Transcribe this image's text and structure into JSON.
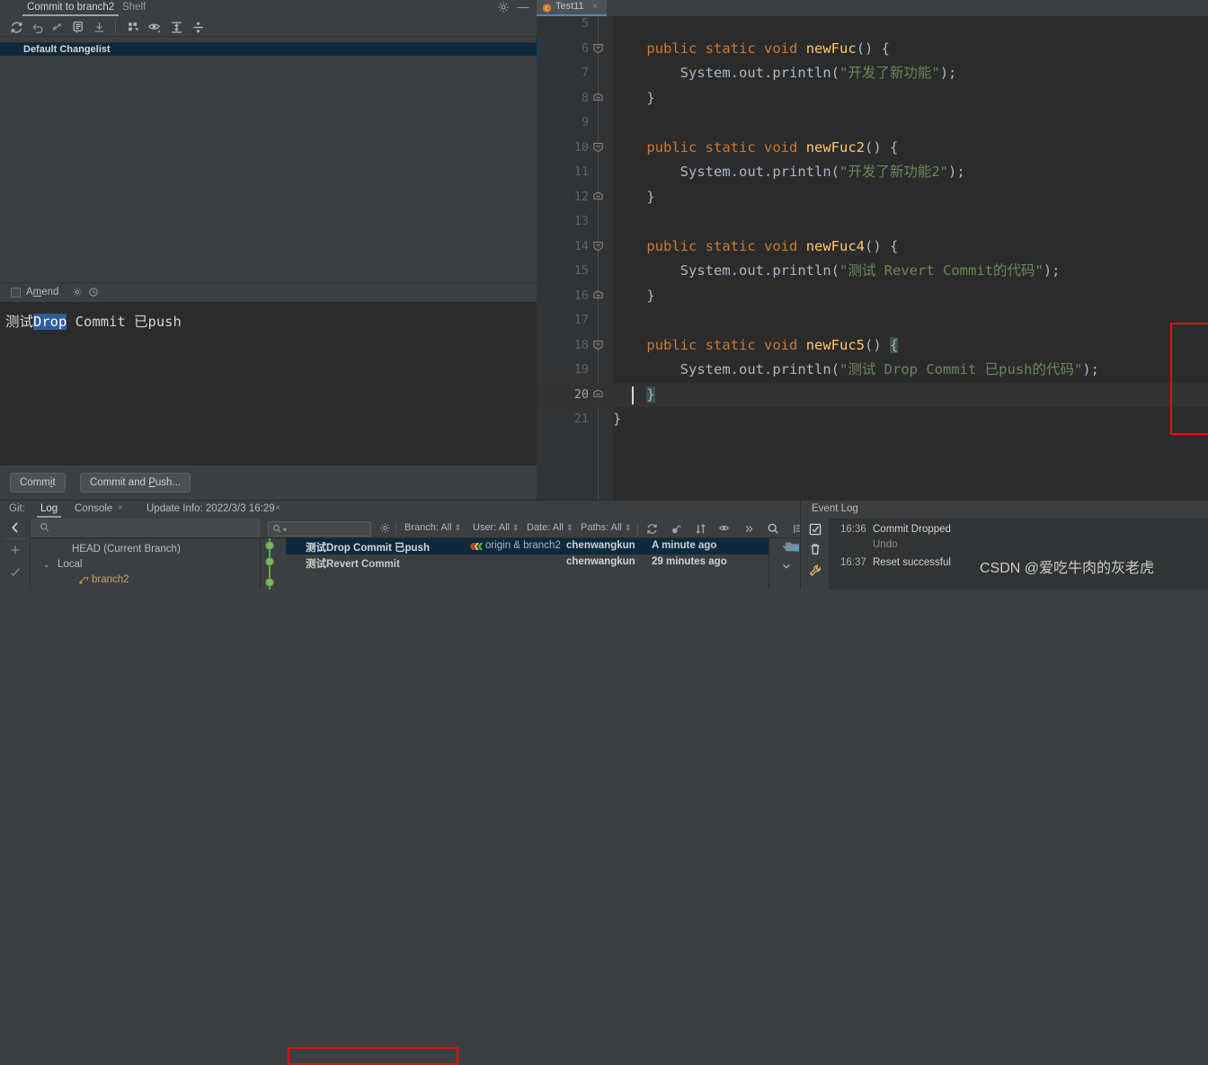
{
  "commit_panel": {
    "tabs": [
      {
        "label": "Commit to branch2",
        "selected": true
      },
      {
        "label": "Shelf",
        "selected": false
      }
    ],
    "toolbar_icons": [
      "refresh-icon",
      "rollback-icon",
      "show-diff-icon",
      "commit-message-icon",
      "shelve-icon",
      "group-by-icon",
      "preview-diff-icon",
      "expand-all-icon",
      "collapse-all-icon"
    ],
    "changelist": "Default Changelist",
    "amend_label": "Amend",
    "commit_message": {
      "before": "测试",
      "selected": "Drop",
      "after": " Commit 已push"
    },
    "buttons": {
      "commit": "Commit",
      "commit_and_push": "Commit and Push..."
    }
  },
  "editor": {
    "tab": {
      "label": "Test11",
      "close": "×"
    },
    "lines": [
      {
        "num": "5",
        "fold": "",
        "code": ""
      },
      {
        "num": "6",
        "fold": "minus",
        "code": "    public static void newFuc() {"
      },
      {
        "num": "7",
        "fold": "",
        "code": "        System.out.println(\"开发了新功能\");"
      },
      {
        "num": "8",
        "fold": "end",
        "code": "    }"
      },
      {
        "num": "9",
        "fold": "",
        "code": ""
      },
      {
        "num": "10",
        "fold": "minus",
        "code": "    public static void newFuc2() {"
      },
      {
        "num": "11",
        "fold": "",
        "code": "        System.out.println(\"开发了新功能2\");"
      },
      {
        "num": "12",
        "fold": "end",
        "code": "    }"
      },
      {
        "num": "13",
        "fold": "",
        "code": ""
      },
      {
        "num": "14",
        "fold": "minus",
        "code": "    public static void newFuc4() {"
      },
      {
        "num": "15",
        "fold": "",
        "code": "        System.out.println(\"测试 Revert Commit的代码\");"
      },
      {
        "num": "16",
        "fold": "end",
        "code": "    }"
      },
      {
        "num": "17",
        "fold": "",
        "code": ""
      },
      {
        "num": "18",
        "fold": "minus",
        "code": "    public static void newFuc5() {"
      },
      {
        "num": "19",
        "fold": "",
        "code": "        System.out.println(\"测试 Drop Commit 已push的代码\");"
      },
      {
        "num": "20",
        "fold": "end",
        "code": "    }"
      },
      {
        "num": "21",
        "fold": "",
        "code": "}"
      }
    ]
  },
  "bottom": {
    "git_label": "Git:",
    "tabs": [
      {
        "label": "Log",
        "selected": true,
        "closable": false
      },
      {
        "label": "Console",
        "selected": false,
        "closable": true
      },
      {
        "label": "Update Info: 2022/3/3 16:29",
        "selected": false,
        "closable": true
      }
    ],
    "branch_tree": [
      {
        "label": "HEAD (Current Branch)",
        "indent": 0,
        "arrow": "",
        "kind": "head"
      },
      {
        "label": "Local",
        "indent": 0,
        "arrow": "⌄",
        "kind": "group"
      },
      {
        "label": "branch2",
        "indent": 1,
        "arrow": "",
        "kind": "branch"
      }
    ],
    "log_toolbar": {
      "search_placeholder": "",
      "filters": [
        {
          "label": "Branch: All"
        },
        {
          "label": "User: All"
        },
        {
          "label": "Date: All"
        },
        {
          "label": "Paths: All"
        }
      ],
      "icons": [
        "refresh-icon",
        "cherry-pick-icon",
        "sort-icon",
        "show-details-icon",
        "more-icon",
        "search-icon",
        "intellisort-icon",
        "collapse-icon"
      ]
    },
    "commits": [
      {
        "subject": "测试Drop Commit 已push",
        "refs": "origin & branch2",
        "author": "chenwangkun",
        "date": "A minute ago",
        "selected": true,
        "highlighted": true
      },
      {
        "subject": "测试Revert Commit",
        "refs": "",
        "author": "chenwangkun",
        "date": "29 minutes ago",
        "selected": false,
        "highlighted": false
      }
    ]
  },
  "event_log": {
    "title": "Event Log",
    "entries": [
      {
        "time": "16:36",
        "message": "Commit Dropped",
        "link": "Undo"
      },
      {
        "time": "16:37",
        "message": "Reset successful",
        "link": ""
      }
    ]
  },
  "watermark": "CSDN @爱吃牛肉的灰老虎"
}
